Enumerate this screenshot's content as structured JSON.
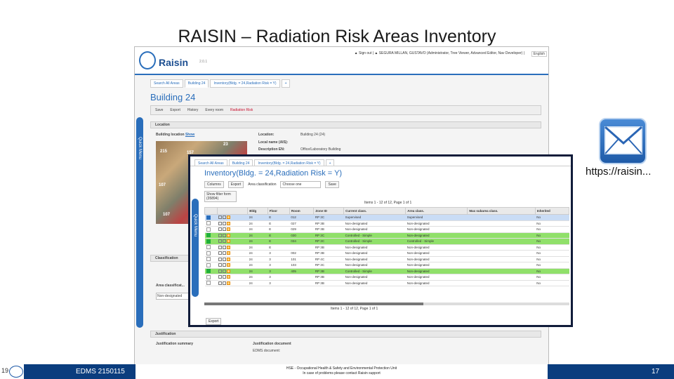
{
  "slide": {
    "title": "RAISIN – Radiation Risk Areas Inventory",
    "url": "https://raisin...",
    "edms": "EDMS 2150115",
    "page_left": "19",
    "page_right": "17"
  },
  "app": {
    "logo": "Raisin",
    "version": "2.0.1",
    "user": "▲ Sign out | ▲ SEGURA MILLAN, GUSTAVO (Administrator, Tree Viewer, Advanced Editor, Nav Developer) |",
    "language": "English",
    "tabs": [
      "Search All Areas",
      "Building 24",
      "Inventory(Bldg. = 24,Radiation Risk = Y)",
      "+"
    ],
    "building_title": "Building 24",
    "toolbar": {
      "save": "Save",
      "export": "Export",
      "history": "History",
      "every_room": "Every room",
      "radiation_risk": "Radiation Risk"
    },
    "quick_menu": "Quick    Menu",
    "location_header": "Location",
    "building_location": "Building location",
    "show": "Show",
    "map_labels": [
      "215",
      "157",
      "23",
      "107",
      "107"
    ],
    "location_fields": [
      {
        "label": "Location:",
        "value": "Building 24 (24)"
      },
      {
        "label": "Local name (AIS):",
        "value": ""
      },
      {
        "label": "Description EN:",
        "value": "Office/Laboratory Building"
      }
    ],
    "classification_header": "Classification",
    "area_classification": "Area classificat...",
    "area_classification_value": "Non-designated",
    "justification_header": "Justification",
    "justification_summary": "Justification summary",
    "justification_document": "Justification document",
    "edms_doc": "EDMS document:",
    "footer_line1": "HSE - Occupational Health & Safety and Environmental Protection Unit",
    "footer_line2": "In case of problems please contact Raisin support"
  },
  "inventory": {
    "tabs": [
      "Search All Areas",
      "Building 24",
      "Inventory(Bldg. = 24,Radiation Risk = Y)",
      "+"
    ],
    "title": "Inventory(Bldg. = 24,Radiation Risk = Y)",
    "columns_btn": "Columns",
    "export_btn": "Export",
    "area_class_label": "Area classification",
    "area_class_value": "Choose one",
    "save_btn": "Save",
    "filter": "Show filter form (35894)",
    "pager": "Items 1 - 12 of 12, Page 1 of 1",
    "pager2": "Items 1 - 12 of 12, Page 1 of 1",
    "export_bottom": "Export",
    "quick_menu": "Quick    Menu",
    "headers": [
      "",
      "",
      "Bldg",
      "Floor",
      "Room",
      "Zone ID",
      "Current class.",
      "Area class.",
      "Max subarea class.",
      "Inherited"
    ],
    "rows": [
      {
        "style": "sel",
        "cb": "on",
        "bldg": "24",
        "floor": "E",
        "room": "012",
        "zone": "RP 3C",
        "current": "Supervised",
        "area": "Supervised",
        "max": "",
        "inherited": "No"
      },
      {
        "style": "",
        "cb": "",
        "bldg": "24",
        "floor": "E",
        "room": "027",
        "zone": "RP 3B",
        "current": "Non-designated",
        "area": "Non-designated",
        "max": "",
        "inherited": "No"
      },
      {
        "style": "",
        "cb": "",
        "bldg": "24",
        "floor": "E",
        "room": "029",
        "zone": "RP 3B",
        "current": "Non-designated",
        "area": "Non-designated",
        "max": "",
        "inherited": "No"
      },
      {
        "style": "hl",
        "cb": "green",
        "bldg": "24",
        "floor": "E",
        "room": "030",
        "zone": "RP 3C",
        "current": "Controlled - Simple",
        "area": "Non-designated",
        "max": "",
        "inherited": "No"
      },
      {
        "style": "hl",
        "cb": "green",
        "bldg": "24",
        "floor": "E",
        "room": "034",
        "zone": "RP 3C",
        "current": "Controlled - Simple",
        "area": "Controlled - Simple",
        "max": "",
        "inherited": "No"
      },
      {
        "style": "",
        "cb": "",
        "bldg": "24",
        "floor": "E",
        "room": "",
        "zone": "RP 3B",
        "current": "Non-designated",
        "area": "Non-designated",
        "max": "",
        "inherited": "No"
      },
      {
        "style": "",
        "cb": "",
        "bldg": "24",
        "floor": "3",
        "room": "002",
        "zone": "RP 3B",
        "current": "Non-designated",
        "area": "Non-designated",
        "max": "",
        "inherited": "No"
      },
      {
        "style": "",
        "cb": "",
        "bldg": "24",
        "floor": "3",
        "room": "101",
        "zone": "RP 4C",
        "current": "Non-designated",
        "area": "Non-designated",
        "max": "",
        "inherited": "No"
      },
      {
        "style": "",
        "cb": "",
        "bldg": "24",
        "floor": "3",
        "room": "103",
        "zone": "RP 3C",
        "current": "Non-designated",
        "area": "Non-designated",
        "max": "",
        "inherited": "No"
      },
      {
        "style": "hl",
        "cb": "green",
        "bldg": "24",
        "floor": "3",
        "room": "405",
        "zone": "RP 3B",
        "current": "Controlled - Simple",
        "area": "Non-designated",
        "max": "",
        "inherited": "No"
      },
      {
        "style": "",
        "cb": "",
        "bldg": "24",
        "floor": "3",
        "room": "",
        "zone": "RP 3B",
        "current": "Non-designated",
        "area": "Non-designated",
        "max": "",
        "inherited": "No"
      },
      {
        "style": "",
        "cb": "",
        "bldg": "24",
        "floor": "3",
        "room": "",
        "zone": "RP 3B",
        "current": "Non-designated",
        "area": "Non-designated",
        "max": "",
        "inherited": "No"
      }
    ]
  }
}
